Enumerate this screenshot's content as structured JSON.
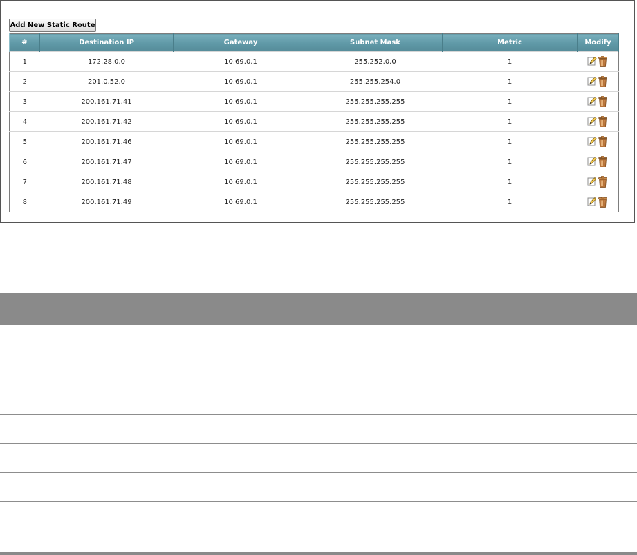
{
  "toolbar": {
    "add_label": "Add New Static Route"
  },
  "table": {
    "columns": [
      "#",
      "Destination IP",
      "Gateway",
      "Subnet Mask",
      "Metric",
      "Modify"
    ],
    "rows": [
      {
        "num": "1",
        "dest": "172.28.0.0",
        "gateway": "10.69.0.1",
        "mask": "255.252.0.0",
        "metric": "1"
      },
      {
        "num": "2",
        "dest": "201.0.52.0",
        "gateway": "10.69.0.1",
        "mask": "255.255.254.0",
        "metric": "1"
      },
      {
        "num": "3",
        "dest": "200.161.71.41",
        "gateway": "10.69.0.1",
        "mask": "255.255.255.255",
        "metric": "1"
      },
      {
        "num": "4",
        "dest": "200.161.71.42",
        "gateway": "10.69.0.1",
        "mask": "255.255.255.255",
        "metric": "1"
      },
      {
        "num": "5",
        "dest": "200.161.71.46",
        "gateway": "10.69.0.1",
        "mask": "255.255.255.255",
        "metric": "1"
      },
      {
        "num": "6",
        "dest": "200.161.71.47",
        "gateway": "10.69.0.1",
        "mask": "255.255.255.255",
        "metric": "1"
      },
      {
        "num": "7",
        "dest": "200.161.71.48",
        "gateway": "10.69.0.1",
        "mask": "255.255.255.255",
        "metric": "1"
      },
      {
        "num": "8",
        "dest": "200.161.71.49",
        "gateway": "10.69.0.1",
        "mask": "255.255.255.255",
        "metric": "1"
      }
    ]
  },
  "icons": {
    "edit": "edit-icon",
    "delete": "trash-icon"
  },
  "colors": {
    "header_teal": "#5f98a6",
    "trash_brown": "#b8743a",
    "doc_header_gray": "#8a8a8a"
  }
}
